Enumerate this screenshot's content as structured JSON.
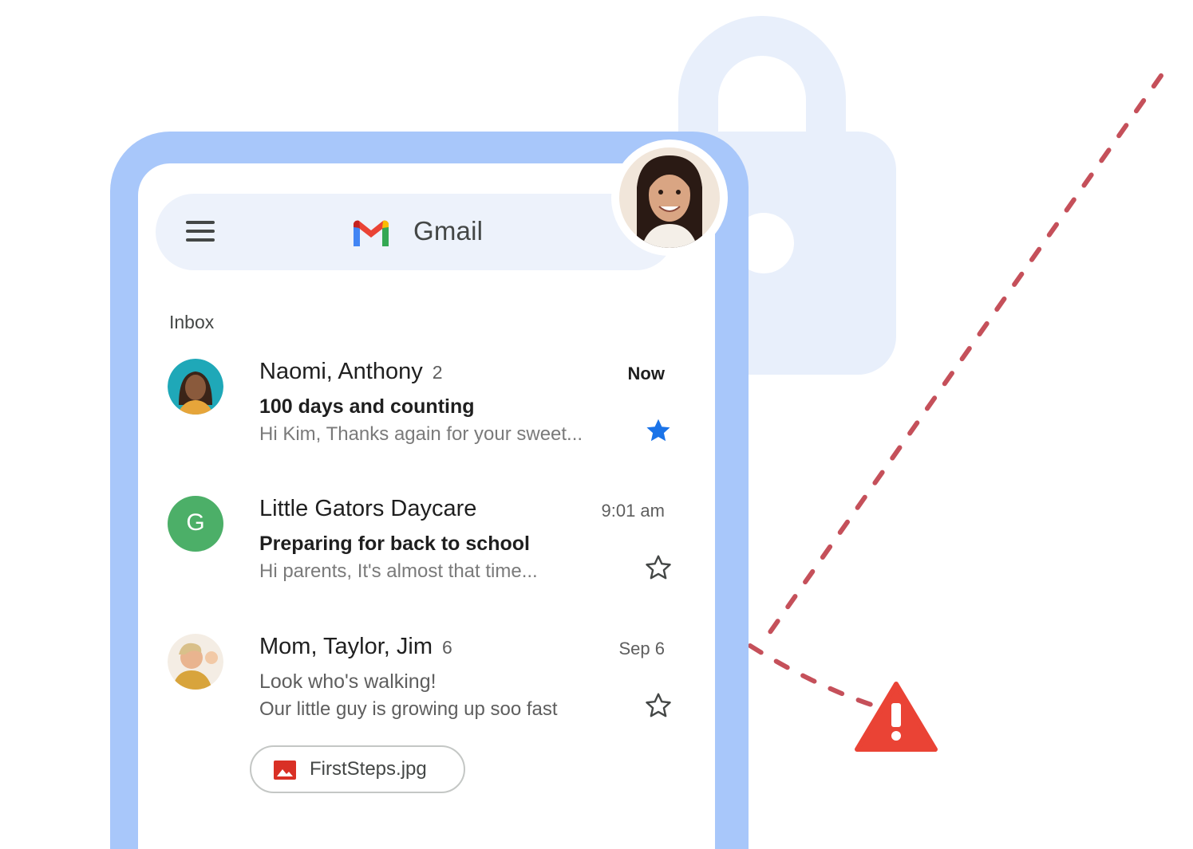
{
  "app": {
    "title": "Gmail",
    "section": "Inbox"
  },
  "emails": [
    {
      "sender": "Naomi, Anthony",
      "count": "2",
      "time": "Now",
      "subject": "100 days and counting",
      "snippet": "Hi Kim, Thanks again for your sweet...",
      "unread": true,
      "starred": true
    },
    {
      "sender": "Little Gators Daycare",
      "count": "",
      "time": "9:01 am",
      "subject": "Preparing for back to school",
      "snippet": "Hi parents, It's almost that time...",
      "unread": true,
      "starred": false,
      "avatar_letter": "G"
    },
    {
      "sender": "Mom, Taylor, Jim",
      "count": "6",
      "time": "Sep 6",
      "subject": "Look who's walking!",
      "snippet": "Our little guy is growing up soo fast",
      "unread": false,
      "starred": false,
      "attachment": "FirstSteps.jpg"
    }
  ],
  "icons": {
    "menu": "hamburger-menu-icon",
    "logo": "gmail-logo-icon",
    "star_filled": "star-filled-icon",
    "star_outline": "star-outline-icon",
    "attachment": "image-file-icon",
    "lock": "lock-icon",
    "warning": "warning-triangle-icon"
  },
  "colors": {
    "phone_frame": "#a8c7fa",
    "app_bar": "#edf2fb",
    "lock": "#e8effb",
    "star": "#1a73e8",
    "daycare_avatar": "#4caf68",
    "warning": "#ea4335",
    "dotted_line": "#c5505a"
  }
}
